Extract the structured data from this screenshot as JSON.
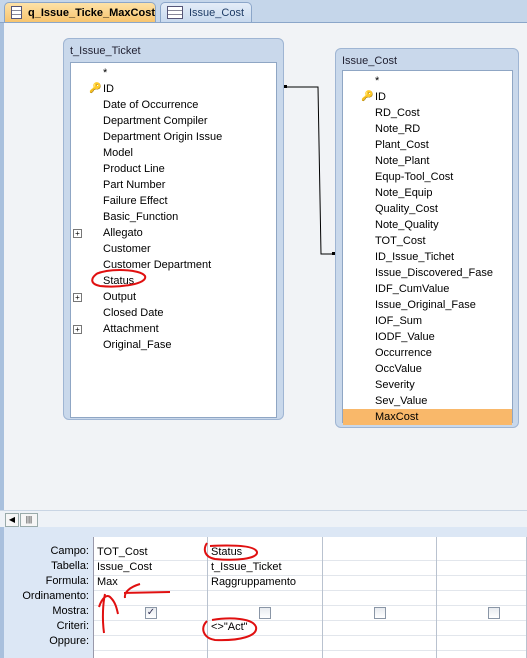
{
  "tabs": [
    {
      "label": "q_Issue_Ticke_MaxCost",
      "active": true,
      "icon": "query-icon"
    },
    {
      "label": "Issue_Cost",
      "active": false,
      "icon": "table-icon"
    }
  ],
  "tables": {
    "ticket": {
      "title": "t_Issue_Ticket",
      "fields": [
        {
          "name": "*"
        },
        {
          "name": "ID",
          "key": true
        },
        {
          "name": "Date of Occurrence"
        },
        {
          "name": "Department Compiler"
        },
        {
          "name": "Department Origin Issue"
        },
        {
          "name": "Model"
        },
        {
          "name": "Product Line"
        },
        {
          "name": "Part Number"
        },
        {
          "name": "Failure Effect"
        },
        {
          "name": "Basic_Function"
        },
        {
          "name": "Allegato",
          "expand": true
        },
        {
          "name": "Customer"
        },
        {
          "name": "Customer Department"
        },
        {
          "name": "Status"
        },
        {
          "name": "Output",
          "expand": true
        },
        {
          "name": "Closed Date"
        },
        {
          "name": "Attachment",
          "expand": true
        },
        {
          "name": "Original_Fase"
        }
      ]
    },
    "cost": {
      "title": "Issue_Cost",
      "fields": [
        {
          "name": "*"
        },
        {
          "name": "ID",
          "key": true
        },
        {
          "name": "RD_Cost"
        },
        {
          "name": "Note_RD"
        },
        {
          "name": "Plant_Cost"
        },
        {
          "name": "Note_Plant"
        },
        {
          "name": "Equp-Tool_Cost"
        },
        {
          "name": "Note_Equip"
        },
        {
          "name": "Quality_Cost"
        },
        {
          "name": "Note_Quality"
        },
        {
          "name": "TOT_Cost"
        },
        {
          "name": "ID_Issue_Tichet"
        },
        {
          "name": "Issue_Discovered_Fase"
        },
        {
          "name": "IDF_CumValue"
        },
        {
          "name": "Issue_Original_Fase"
        },
        {
          "name": "IOF_Sum"
        },
        {
          "name": "IODF_Value"
        },
        {
          "name": "Occurrence"
        },
        {
          "name": "OccValue"
        },
        {
          "name": "Severity"
        },
        {
          "name": "Sev_Value"
        },
        {
          "name": "MaxCost",
          "selected": true
        }
      ]
    }
  },
  "grid": {
    "row_labels": [
      "Campo:",
      "Tabella:",
      "Formula:",
      "Ordinamento:",
      "Mostra:",
      "Criteri:",
      "Oppure:"
    ],
    "columns": [
      {
        "campo": "TOT_Cost",
        "tabella": "Issue_Cost",
        "formula": "Max",
        "ordinamento": "",
        "mostra": true,
        "criteri": ""
      },
      {
        "campo": "Status",
        "tabella": "t_Issue_Ticket",
        "formula": "Raggruppamento",
        "ordinamento": "",
        "mostra": false,
        "criteri": "<>\"Act\""
      },
      {
        "campo": "",
        "tabella": "",
        "formula": "",
        "ordinamento": "",
        "mostra": false,
        "criteri": ""
      },
      {
        "campo": "",
        "tabella": "",
        "formula": "",
        "ordinamento": "",
        "mostra": false,
        "criteri": ""
      }
    ]
  },
  "colors": {
    "selected_row": "#f9b86a",
    "annotation": "#e01010",
    "active_tab": "#f7c46e"
  }
}
